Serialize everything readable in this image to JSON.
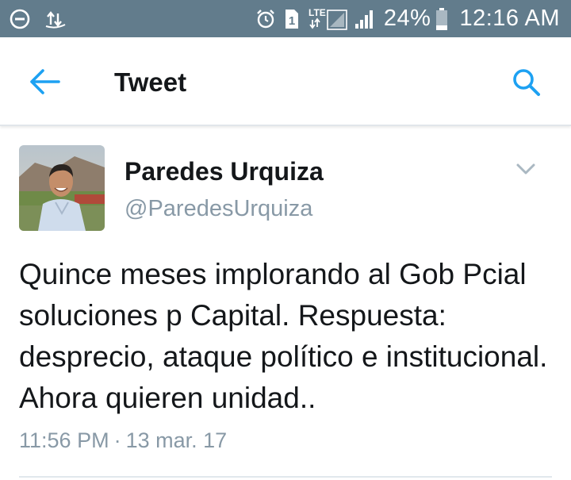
{
  "status_bar": {
    "icons_left": [
      "do-not-disturb-icon",
      "data-sync-icon"
    ],
    "icons_right": [
      "alarm-icon",
      "sim-1-icon",
      "lte-signal-icon",
      "signal-icon"
    ],
    "lte_label": "LTE",
    "sim_label": "1",
    "battery_percent": "24%",
    "time": "12:16 AM"
  },
  "header": {
    "title": "Tweet"
  },
  "tweet": {
    "author_name": "Paredes Urquiza",
    "author_handle": "@ParedesUrquiza",
    "text": "Quince meses implorando al Gob Pcial soluciones p Capital. Respuesta: desprecio, ataque político e institucional. Ahora quieren unidad..",
    "time": "11:56 PM",
    "separator": "·",
    "date": "13 mar. 17"
  },
  "colors": {
    "status_bar_bg": "#627c8c",
    "accent": "#1da1f2",
    "text_primary": "#14171a",
    "text_secondary": "#8899a6"
  }
}
